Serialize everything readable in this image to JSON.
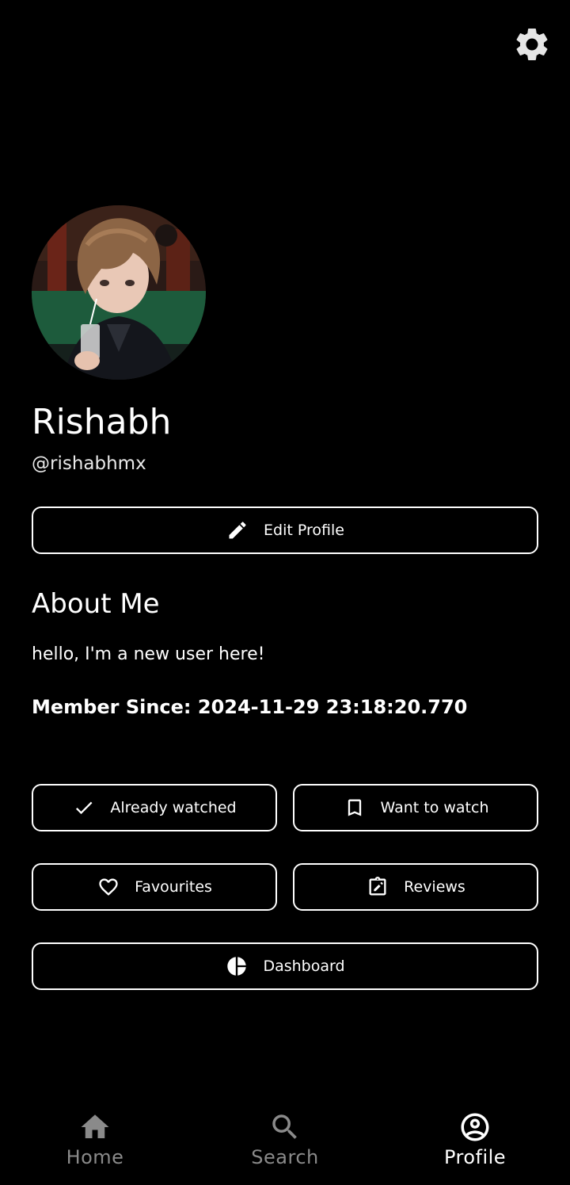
{
  "profile": {
    "name": "Rishabh",
    "handle": "@rishabhmx",
    "edit_label": "Edit Profile"
  },
  "about": {
    "title": "About Me",
    "text": "hello, I'm a new user here!",
    "member_since_label": "Member Since:",
    "member_since_value": "2024-11-29 23:18:20.770"
  },
  "actions": {
    "watched": "Already watched",
    "want": "Want to watch",
    "favourites": "Favourites",
    "reviews": "Reviews",
    "dashboard": "Dashboard"
  },
  "nav": {
    "home": "Home",
    "search": "Search",
    "profile": "Profile",
    "active": "profile"
  },
  "icons": {
    "settings": "gear-icon",
    "edit": "pencil-icon",
    "watched": "check-icon",
    "want": "bookmark-icon",
    "favourites": "heart-icon",
    "reviews": "review-icon",
    "dashboard": "pie-chart-icon",
    "home": "home-icon",
    "search": "search-icon",
    "profile": "account-circle-icon"
  },
  "colors": {
    "background": "#000000",
    "text": "#ffffff",
    "nav_inactive": "#8a8a8a"
  }
}
